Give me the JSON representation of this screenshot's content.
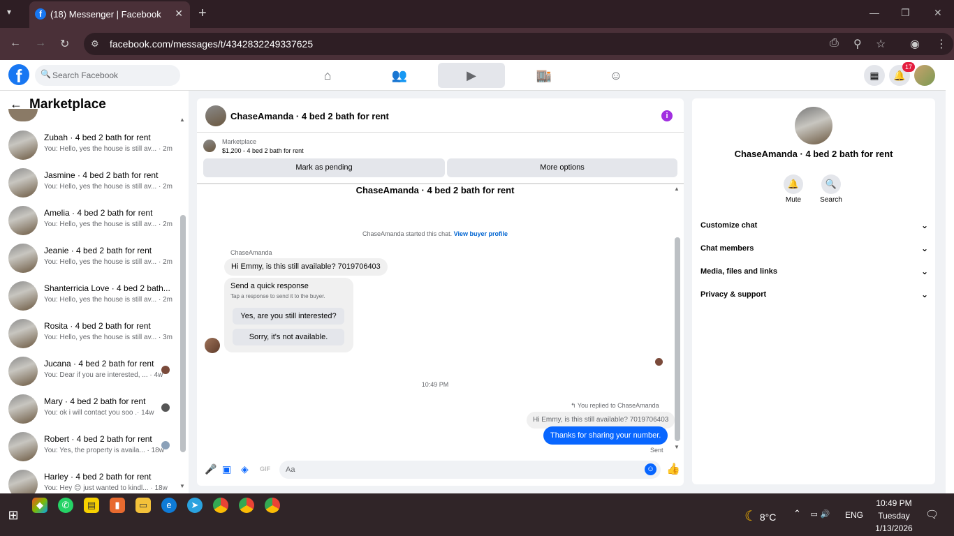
{
  "browser": {
    "tab_title": "(18) Messenger | Facebook",
    "url": "facebook.com/messages/t/4342832249337625"
  },
  "fb": {
    "search_placeholder": "Search Facebook",
    "notif_count": "17",
    "brand_color": "#1877f2"
  },
  "sidebar": {
    "title": "Marketplace",
    "conversations": [
      {
        "name": "Zubah · 4 bed 2 bath for rent",
        "preview": "You: Hello, yes the house is still av... · 2m"
      },
      {
        "name": "Jasmine · 4 bed 2 bath for rent",
        "preview": "You: Hello, yes the house is still av... · 2m"
      },
      {
        "name": "Amelia · 4 bed 2 bath for rent",
        "preview": "You: Hello, yes the house is still av... · 2m"
      },
      {
        "name": "Jeanie · 4 bed 2 bath for rent",
        "preview": "You: Hello, yes the house is still av... · 2m"
      },
      {
        "name": "Shanterricia Love · 4 bed 2 bath...",
        "preview": "You: Hello, yes the house is still av... · 2m"
      },
      {
        "name": "Rosita · 4 bed 2 bath for rent",
        "preview": "You: Hello, yes the house is still av... · 3m"
      },
      {
        "name": "Jucana · 4 bed 2 bath for rent",
        "preview": "You: Dear if you are interested, ... · 4w"
      },
      {
        "name": "Mary · 4 bed 2 bath for rent",
        "preview": "You: ok i will contact you soo .· 14w"
      },
      {
        "name": "Robert · 4 bed 2 bath for rent",
        "preview": "You: Yes, the property is availa... · 18w"
      },
      {
        "name": "Harley · 4 bed 2 bath for rent",
        "preview": "You: Hey 😊 just wanted to kindl... · 18w"
      }
    ]
  },
  "chat": {
    "title": "ChaseAmanda · 4 bed 2 bath for rent",
    "marketplace_label": "Marketplace",
    "listing": "$1,200 - 4 bed 2 bath for rent",
    "mark_pending": "Mark as pending",
    "more_options": "More options",
    "started_text": "ChaseAmanda started this chat.",
    "view_profile": "View buyer profile",
    "sender_name": "ChaseAmanda",
    "incoming_msg": "Hi Emmy, is this still available? 7019706403",
    "quick_title": "Send a quick response",
    "quick_sub": "Tap a response to send it to the buyer.",
    "quick_1": "Yes, are you still interested?",
    "quick_2": "Sorry, it's not available.",
    "timestamp": "10:49 PM",
    "replied_to": "You replied to ChaseAmanda",
    "quoted": "Hi Emmy, is this still available? 7019706403",
    "my_msg": "Thanks for sharing your number.",
    "status": "Sent",
    "compose_placeholder": "Aa"
  },
  "details": {
    "name": "ChaseAmanda · 4 bed 2 bath for rent",
    "mute": "Mute",
    "search": "Search",
    "rows": [
      "Customize chat",
      "Chat members",
      "Media, files and links",
      "Privacy & support"
    ]
  },
  "taskbar": {
    "temp": "8°C",
    "lang": "ENG",
    "time": "10:49 PM",
    "day": "Tuesday",
    "date": "1/13/2026"
  }
}
